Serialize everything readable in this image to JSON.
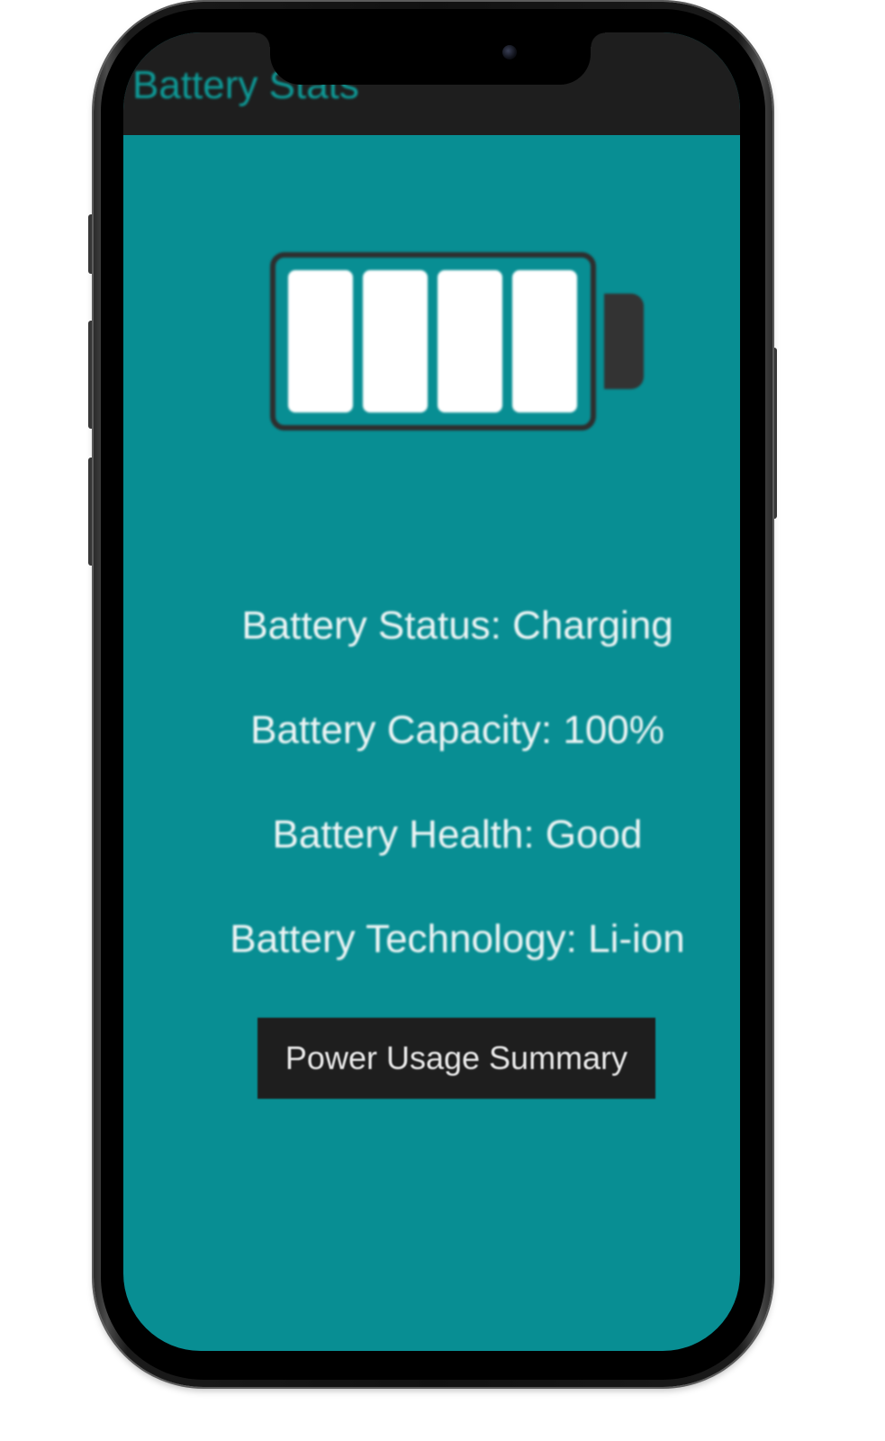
{
  "app_bar": {
    "title": "Battery Stats"
  },
  "battery_icon": {
    "icon": "battery-full-icon",
    "filled_cells": 4,
    "total_cells": 4
  },
  "info": {
    "status": "Battery Status: Charging",
    "capacity": "Battery Capacity: 100%",
    "health": "Battery Health: Good",
    "technology": "Battery Technology: Li-ion"
  },
  "actions": {
    "power_usage_summary": "Power Usage Summary"
  },
  "colors": {
    "screen_background": "#088e93",
    "app_bar_background": "#1e1e1e",
    "title_color": "#0e9a97",
    "text_color": "#eef5f5",
    "button_background": "#1e1e1e"
  }
}
